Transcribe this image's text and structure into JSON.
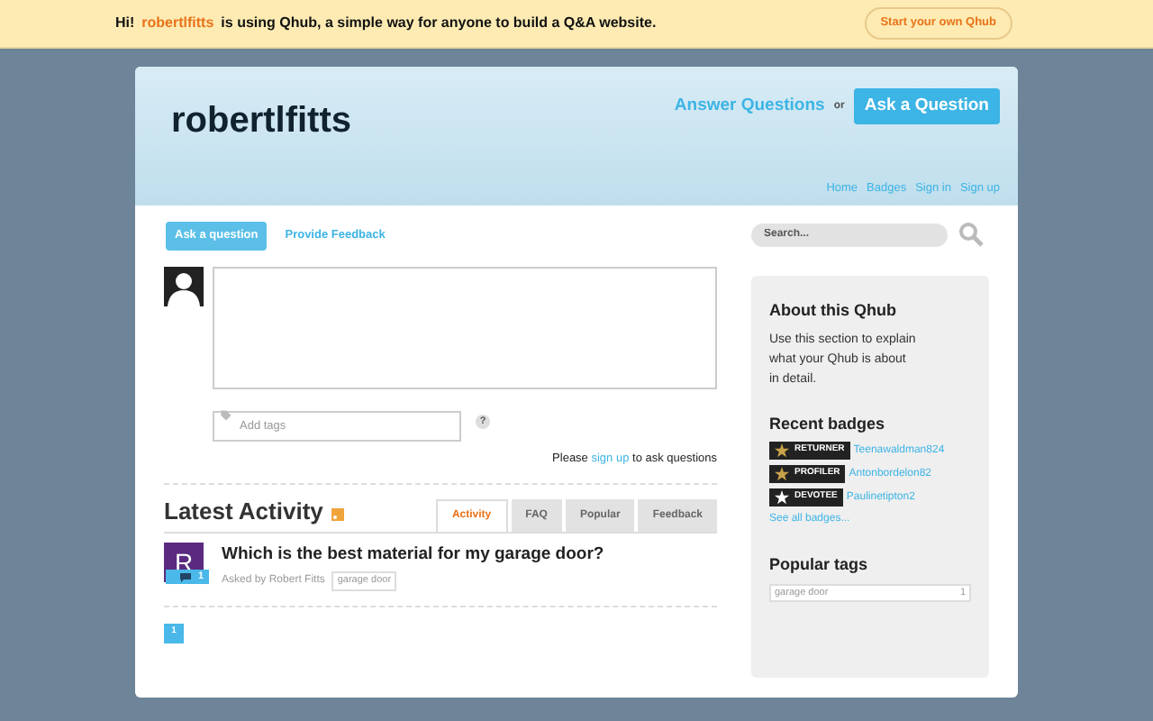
{
  "banner": {
    "greeting": "Hi!",
    "user": "robertlfitts",
    "message": "is using Qhub, a simple way for anyone to build a Q&A website.",
    "button": "Start your own Qhub"
  },
  "header": {
    "site_title": "robertlfitts",
    "answer_link": "Answer Questions",
    "or": "or",
    "ask_button": "Ask a Question",
    "nav": [
      "Home",
      "Badges",
      "Sign in",
      "Sign up"
    ]
  },
  "ask_tabs": [
    {
      "label": "Ask a question",
      "selected": true
    },
    {
      "label": "Provide Feedback",
      "selected": false
    }
  ],
  "tags_field": {
    "placeholder": "Add tags"
  },
  "help": "?",
  "signup_note": {
    "before": "Please",
    "link": "sign up",
    "after": "to ask questions"
  },
  "activity": {
    "title": "Latest Activity",
    "tabs": [
      {
        "label": "Activity",
        "selected": true
      },
      {
        "label": "FAQ",
        "selected": false
      },
      {
        "label": "Popular",
        "selected": false
      },
      {
        "label": "Feedback",
        "selected": false
      }
    ],
    "items": [
      {
        "avatar_letter": "R",
        "answers": "1",
        "question": "Which is the best material for my garage door?",
        "asked_by": "Asked by Robert Fitts",
        "tags": [
          "garage door"
        ]
      }
    ],
    "pages": [
      {
        "label": "1",
        "selected": true
      }
    ]
  },
  "search": {
    "placeholder": "Search..."
  },
  "about": {
    "title": "About this Qhub",
    "text": "Use this section to explain what your Qhub is about in detail."
  },
  "recent_badges": {
    "title": "Recent badges",
    "items": [
      {
        "badge": "RETURNER",
        "color": "#c9a24a",
        "user": "Teenawaldman824"
      },
      {
        "badge": "PROFILER",
        "color": "#c9a24a",
        "user": "Antonbordelon82"
      },
      {
        "badge": "DEVOTEE",
        "color": "#ffffff",
        "user": "Paulinetipton2"
      }
    ],
    "see_all": "See all badges..."
  },
  "popular_tags": {
    "title": "Popular tags",
    "items": [
      {
        "tag": "garage door",
        "count": "1"
      }
    ]
  }
}
